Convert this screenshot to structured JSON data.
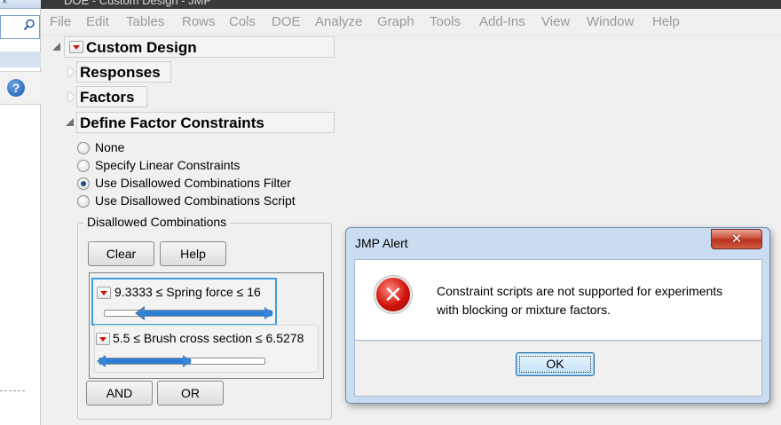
{
  "window": {
    "title": "DOE - Custom Design - JMP",
    "left_tab_glyph": "×"
  },
  "menu": [
    "File",
    "Edit",
    "Tables",
    "Rows",
    "Cols",
    "DOE",
    "Analyze",
    "Graph",
    "Tools",
    "Add-Ins",
    "View",
    "Window",
    "Help"
  ],
  "outline": {
    "custom_design": "Custom Design",
    "responses": "Responses",
    "factors": "Factors",
    "define_constraints": "Define Factor Constraints"
  },
  "constraints": {
    "options": [
      {
        "label": "None",
        "selected": false
      },
      {
        "label": "Specify Linear Constraints",
        "selected": false
      },
      {
        "label": "Use Disallowed Combinations Filter",
        "selected": true
      },
      {
        "label": "Use Disallowed Combinations Script",
        "selected": false
      }
    ],
    "group_title": "Disallowed Combinations",
    "clear_label": "Clear",
    "help_label": "Help",
    "and_label": "AND",
    "or_label": "OR",
    "filters": [
      {
        "text": "9.3333  ≤  Spring force  ≤  16",
        "low_fraction": 0.2,
        "high_fraction": 1.0
      },
      {
        "text": "5.5  ≤  Brush cross section  ≤  6.5278",
        "low_fraction": 0.0,
        "high_fraction": 0.55
      }
    ]
  },
  "alert": {
    "title": "JMP Alert",
    "close_glyph": "✕",
    "message_line1": "Constraint scripts are not supported for experiments",
    "message_line2": "with blocking or mixture factors.",
    "ok_label": "OK",
    "icon": "error-icon"
  },
  "colors": {
    "accent_blue": "#2a7fd4",
    "focus_border": "#3b9ee0",
    "error_red": "#d0140b",
    "close_red": "#c7452f",
    "menu_disabled": "#9a9a9a"
  }
}
